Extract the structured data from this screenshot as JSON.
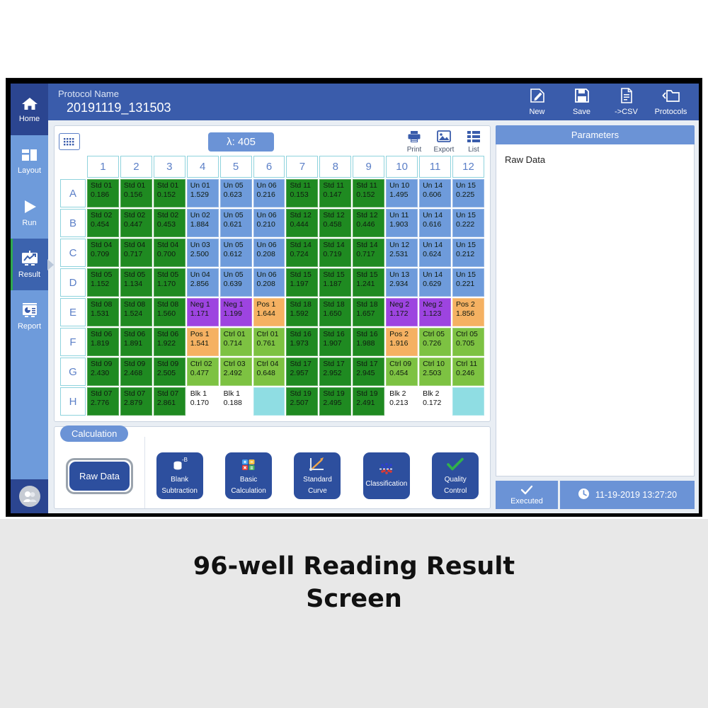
{
  "caption": {
    "line1": "96-well Reading Result",
    "line2": "Screen"
  },
  "sidebar": {
    "items": [
      {
        "label": "Home",
        "icon": "home-icon",
        "active": false
      },
      {
        "label": "Layout",
        "icon": "layout-icon",
        "active": false
      },
      {
        "label": "Run",
        "icon": "play-icon",
        "active": false
      },
      {
        "label": "Result",
        "icon": "chart-icon",
        "active": true
      },
      {
        "label": "Report",
        "icon": "report-icon",
        "active": false
      }
    ],
    "avatar_icon": "user-avatar-icon"
  },
  "header": {
    "protocol_label": "Protocol Name",
    "protocol_value": "20191119_131503",
    "actions": [
      {
        "label": "New",
        "icon": "new-document-icon"
      },
      {
        "label": "Save",
        "icon": "floppy-save-icon"
      },
      {
        "label": "->CSV",
        "icon": "csv-export-icon"
      },
      {
        "label": "Protocols",
        "icon": "folder-back-icon"
      }
    ]
  },
  "plate_toolbar": {
    "grid_icon": "plate-grid-icon",
    "wavelength": "λ: 405",
    "tools": [
      {
        "label": "Print",
        "icon": "printer-icon"
      },
      {
        "label": "Export",
        "icon": "image-export-icon"
      },
      {
        "label": "List",
        "icon": "list-view-icon"
      }
    ]
  },
  "plate": {
    "columns": [
      "1",
      "2",
      "3",
      "4",
      "5",
      "6",
      "7",
      "8",
      "9",
      "10",
      "11",
      "12"
    ],
    "rows": [
      "A",
      "B",
      "C",
      "D",
      "E",
      "F",
      "G",
      "H"
    ],
    "wells": [
      [
        {
          "l": "Std 01",
          "v": "0.186",
          "t": "std"
        },
        {
          "l": "Std 01",
          "v": "0.156",
          "t": "std"
        },
        {
          "l": "Std 01",
          "v": "0.152",
          "t": "std"
        },
        {
          "l": "Un 01",
          "v": "1.529",
          "t": "un"
        },
        {
          "l": "Un 05",
          "v": "0.623",
          "t": "un"
        },
        {
          "l": "Un 06",
          "v": "0.216",
          "t": "un"
        },
        {
          "l": "Std 11",
          "v": "0.153",
          "t": "std"
        },
        {
          "l": "Std 11",
          "v": "0.147",
          "t": "std"
        },
        {
          "l": "Std 11",
          "v": "0.152",
          "t": "std"
        },
        {
          "l": "Un 10",
          "v": "1.495",
          "t": "un"
        },
        {
          "l": "Un 14",
          "v": "0.606",
          "t": "un"
        },
        {
          "l": "Un 15",
          "v": "0.225",
          "t": "un"
        }
      ],
      [
        {
          "l": "Std 02",
          "v": "0.454",
          "t": "std"
        },
        {
          "l": "Std 02",
          "v": "0.447",
          "t": "std"
        },
        {
          "l": "Std 02",
          "v": "0.453",
          "t": "std"
        },
        {
          "l": "Un 02",
          "v": "1.884",
          "t": "un"
        },
        {
          "l": "Un 05",
          "v": "0.621",
          "t": "un"
        },
        {
          "l": "Un 06",
          "v": "0.210",
          "t": "un"
        },
        {
          "l": "Std 12",
          "v": "0.444",
          "t": "std"
        },
        {
          "l": "Std 12",
          "v": "0.458",
          "t": "std"
        },
        {
          "l": "Std 12",
          "v": "0.446",
          "t": "std"
        },
        {
          "l": "Un 11",
          "v": "1.903",
          "t": "un"
        },
        {
          "l": "Un 14",
          "v": "0.616",
          "t": "un"
        },
        {
          "l": "Un 15",
          "v": "0.222",
          "t": "un"
        }
      ],
      [
        {
          "l": "Std 04",
          "v": "0.709",
          "t": "std"
        },
        {
          "l": "Std 04",
          "v": "0.717",
          "t": "std"
        },
        {
          "l": "Std 04",
          "v": "0.700",
          "t": "std"
        },
        {
          "l": "Un 03",
          "v": "2.500",
          "t": "un"
        },
        {
          "l": "Un 05",
          "v": "0.612",
          "t": "un"
        },
        {
          "l": "Un 06",
          "v": "0.208",
          "t": "un"
        },
        {
          "l": "Std 14",
          "v": "0.724",
          "t": "std"
        },
        {
          "l": "Std 14",
          "v": "0.719",
          "t": "std"
        },
        {
          "l": "Std 14",
          "v": "0.717",
          "t": "std"
        },
        {
          "l": "Un 12",
          "v": "2.531",
          "t": "un"
        },
        {
          "l": "Un 14",
          "v": "0.624",
          "t": "un"
        },
        {
          "l": "Un 15",
          "v": "0.212",
          "t": "un"
        }
      ],
      [
        {
          "l": "Std 05",
          "v": "1.152",
          "t": "std"
        },
        {
          "l": "Std 05",
          "v": "1.134",
          "t": "std"
        },
        {
          "l": "Std 05",
          "v": "1.170",
          "t": "std"
        },
        {
          "l": "Un 04",
          "v": "2.856",
          "t": "un"
        },
        {
          "l": "Un 05",
          "v": "0.639",
          "t": "un"
        },
        {
          "l": "Un 06",
          "v": "0.208",
          "t": "un"
        },
        {
          "l": "Std 15",
          "v": "1.197",
          "t": "std"
        },
        {
          "l": "Std 15",
          "v": "1.187",
          "t": "std"
        },
        {
          "l": "Std 15",
          "v": "1.241",
          "t": "std"
        },
        {
          "l": "Un 13",
          "v": "2.934",
          "t": "un"
        },
        {
          "l": "Un 14",
          "v": "0.629",
          "t": "un"
        },
        {
          "l": "Un 15",
          "v": "0.221",
          "t": "un"
        }
      ],
      [
        {
          "l": "Std 08",
          "v": "1.531",
          "t": "std"
        },
        {
          "l": "Std 08",
          "v": "1.524",
          "t": "std"
        },
        {
          "l": "Std 08",
          "v": "1.560",
          "t": "std"
        },
        {
          "l": "Neg 1",
          "v": "1.171",
          "t": "neg"
        },
        {
          "l": "Neg 1",
          "v": "1.199",
          "t": "neg"
        },
        {
          "l": "Pos 1",
          "v": "1.644",
          "t": "pos"
        },
        {
          "l": "Std 18",
          "v": "1.592",
          "t": "std"
        },
        {
          "l": "Std 18",
          "v": "1.650",
          "t": "std"
        },
        {
          "l": "Std 18",
          "v": "1.657",
          "t": "std"
        },
        {
          "l": "Neg 2",
          "v": "1.172",
          "t": "neg"
        },
        {
          "l": "Neg 2",
          "v": "1.123",
          "t": "neg"
        },
        {
          "l": "Pos 2",
          "v": "1.856",
          "t": "pos"
        }
      ],
      [
        {
          "l": "Std 06",
          "v": "1.819",
          "t": "std"
        },
        {
          "l": "Std 06",
          "v": "1.891",
          "t": "std"
        },
        {
          "l": "Std 06",
          "v": "1.922",
          "t": "std"
        },
        {
          "l": "Pos 1",
          "v": "1.541",
          "t": "pos"
        },
        {
          "l": "Ctrl 01",
          "v": "0.714",
          "t": "ctrl"
        },
        {
          "l": "Ctrl 01",
          "v": "0.761",
          "t": "ctrl"
        },
        {
          "l": "Std 16",
          "v": "1.973",
          "t": "std"
        },
        {
          "l": "Std 16",
          "v": "1.907",
          "t": "std"
        },
        {
          "l": "Std 16",
          "v": "1.988",
          "t": "std"
        },
        {
          "l": "Pos 2",
          "v": "1.916",
          "t": "pos"
        },
        {
          "l": "Ctrl 05",
          "v": "0.726",
          "t": "ctrl"
        },
        {
          "l": "Ctrl 05",
          "v": "0.705",
          "t": "ctrl"
        }
      ],
      [
        {
          "l": "Std 09",
          "v": "2.430",
          "t": "std"
        },
        {
          "l": "Std 09",
          "v": "2.468",
          "t": "std"
        },
        {
          "l": "Std 09",
          "v": "2.505",
          "t": "std"
        },
        {
          "l": "Ctrl 02",
          "v": "0.477",
          "t": "ctrl"
        },
        {
          "l": "Ctrl 03",
          "v": "2.492",
          "t": "ctrl"
        },
        {
          "l": "Ctrl 04",
          "v": "0.648",
          "t": "ctrl"
        },
        {
          "l": "Std 17",
          "v": "2.957",
          "t": "std"
        },
        {
          "l": "Std 17",
          "v": "2.952",
          "t": "std"
        },
        {
          "l": "Std 17",
          "v": "2.945",
          "t": "std"
        },
        {
          "l": "Ctrl 09",
          "v": "0.454",
          "t": "ctrl"
        },
        {
          "l": "Ctrl 10",
          "v": "2.503",
          "t": "ctrl"
        },
        {
          "l": "Ctrl 11",
          "v": "0.246",
          "t": "ctrl"
        }
      ],
      [
        {
          "l": "Std 07",
          "v": "2.776",
          "t": "std"
        },
        {
          "l": "Std 07",
          "v": "2.879",
          "t": "std"
        },
        {
          "l": "Std 07",
          "v": "2.861",
          "t": "std"
        },
        {
          "l": "Blk 1",
          "v": "0.170",
          "t": "blk"
        },
        {
          "l": "Blk 1",
          "v": "0.188",
          "t": "blk"
        },
        {
          "l": "",
          "v": "",
          "t": "empty"
        },
        {
          "l": "Std 19",
          "v": "2.507",
          "t": "std"
        },
        {
          "l": "Std 19",
          "v": "2.495",
          "t": "std"
        },
        {
          "l": "Std 19",
          "v": "2.491",
          "t": "std"
        },
        {
          "l": "Blk 2",
          "v": "0.213",
          "t": "blk"
        },
        {
          "l": "Blk 2",
          "v": "0.172",
          "t": "blk"
        },
        {
          "l": "",
          "v": "",
          "t": "empty"
        }
      ]
    ]
  },
  "calculation": {
    "tab_label": "Calculation",
    "selected": "Raw Data",
    "buttons": [
      {
        "line1": "Blank",
        "line2": "Subtraction",
        "icon": "blank-subtraction-icon"
      },
      {
        "line1": "Basic",
        "line2": "Calculation",
        "icon": "basic-calculation-icon"
      },
      {
        "line1": "Standard",
        "line2": "Curve",
        "icon": "standard-curve-icon"
      },
      {
        "line1": "Classification",
        "line2": "",
        "icon": "classification-icon"
      },
      {
        "line1": "Quality",
        "line2": "Control",
        "icon": "quality-control-icon"
      }
    ]
  },
  "parameters": {
    "title": "Parameters",
    "content": "Raw Data"
  },
  "status": {
    "executed_label": "Executed",
    "executed_icon": "check-icon",
    "clock_icon": "clock-icon",
    "timestamp": "11-19-2019 13:27:20"
  },
  "colors": {
    "brand_dark": "#2b4590",
    "brand": "#3a5cab",
    "rail": "#6e9bdb",
    "accent": "#6b93d6",
    "std": "#1f8a21",
    "unknown": "#6e9bdb",
    "negative": "#9d44e0",
    "positive": "#f5b162",
    "control": "#7dc242",
    "blank": "#ffffff",
    "empty": "#8fdde3"
  }
}
